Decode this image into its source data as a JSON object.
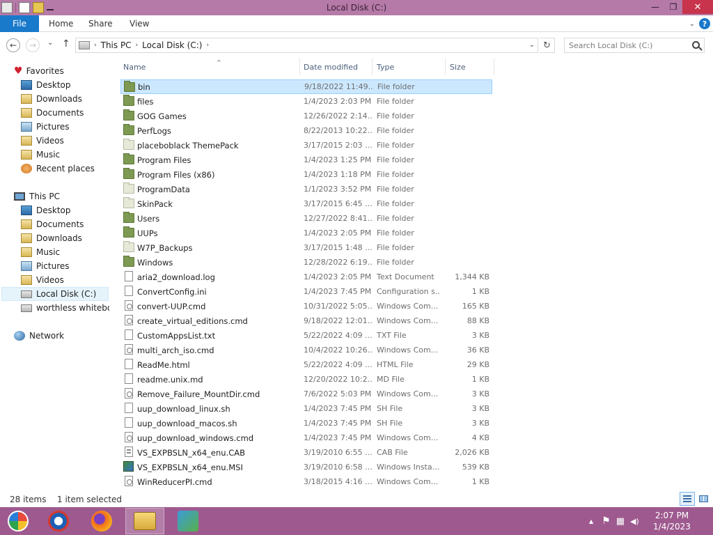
{
  "window": {
    "title": "Local Disk (C:)",
    "minimize_glyph": "—",
    "restore_glyph": "❐",
    "close_glyph": "✕"
  },
  "ribbon": {
    "tabs": [
      "File",
      "Home",
      "Share",
      "View"
    ],
    "expand_glyph": "⌄",
    "help_glyph": "?"
  },
  "nav": {
    "back_glyph": "←",
    "forward_glyph": "→",
    "recent_glyph": "⌄",
    "up_glyph": "↑",
    "refresh_glyph": "↻"
  },
  "address": {
    "segments": [
      "This PC",
      "Local Disk (C:)"
    ],
    "separator_glyph": "›",
    "dropdown_glyph": "⌄"
  },
  "search": {
    "placeholder": "Search Local Disk (C:)"
  },
  "navpane": {
    "favorites_label": "Favorites",
    "favorites": [
      "Desktop",
      "Downloads",
      "Documents",
      "Pictures",
      "Videos",
      "Music",
      "Recent places"
    ],
    "thispc_label": "This PC",
    "thispc": [
      "Desktop",
      "Documents",
      "Downloads",
      "Music",
      "Pictures",
      "Videos",
      "Local Disk (C:)",
      "worthless whiteboard"
    ],
    "network_label": "Network"
  },
  "columns": {
    "name": "Name",
    "date": "Date modified",
    "type": "Type",
    "size": "Size",
    "sort_glyph": "^"
  },
  "files": [
    {
      "name": "bin",
      "date": "9/18/2022 11:49...",
      "type": "File folder",
      "size": ""
    },
    {
      "name": "files",
      "date": "1/4/2023 2:03 PM",
      "type": "File folder",
      "size": ""
    },
    {
      "name": "GOG Games",
      "date": "12/26/2022 2:14...",
      "type": "File folder",
      "size": ""
    },
    {
      "name": "PerfLogs",
      "date": "8/22/2013 10:22...",
      "type": "File folder",
      "size": ""
    },
    {
      "name": "placeboblack ThemePack",
      "date": "3/17/2015 2:03 ...",
      "type": "File folder",
      "size": ""
    },
    {
      "name": "Program Files",
      "date": "1/4/2023 1:25 PM",
      "type": "File folder",
      "size": ""
    },
    {
      "name": "Program Files (x86)",
      "date": "1/4/2023 1:18 PM",
      "type": "File folder",
      "size": ""
    },
    {
      "name": "ProgramData",
      "date": "1/1/2023 3:52 PM",
      "type": "File folder",
      "size": ""
    },
    {
      "name": "SkinPack",
      "date": "3/17/2015 6:45 ...",
      "type": "File folder",
      "size": ""
    },
    {
      "name": "Users",
      "date": "12/27/2022 8:41...",
      "type": "File folder",
      "size": ""
    },
    {
      "name": "UUPs",
      "date": "1/4/2023 2:05 PM",
      "type": "File folder",
      "size": ""
    },
    {
      "name": "W7P_Backups",
      "date": "3/17/2015 1:48 ...",
      "type": "File folder",
      "size": ""
    },
    {
      "name": "Windows",
      "date": "12/28/2022 6:19...",
      "type": "File folder",
      "size": ""
    },
    {
      "name": "aria2_download.log",
      "date": "1/4/2023 2:05 PM",
      "type": "Text Document",
      "size": "1,344 KB"
    },
    {
      "name": "ConvertConfig.ini",
      "date": "1/4/2023 7:45 PM",
      "type": "Configuration s...",
      "size": "1 KB"
    },
    {
      "name": "convert-UUP.cmd",
      "date": "10/31/2022 5:05...",
      "type": "Windows Com...",
      "size": "165 KB"
    },
    {
      "name": "create_virtual_editions.cmd",
      "date": "9/18/2022 12:01...",
      "type": "Windows Com...",
      "size": "88 KB"
    },
    {
      "name": "CustomAppsList.txt",
      "date": "5/22/2022 4:09 ...",
      "type": "TXT File",
      "size": "3 KB"
    },
    {
      "name": "multi_arch_iso.cmd",
      "date": "10/4/2022 10:26...",
      "type": "Windows Com...",
      "size": "36 KB"
    },
    {
      "name": "ReadMe.html",
      "date": "5/22/2022 4:09 ...",
      "type": "HTML File",
      "size": "29 KB"
    },
    {
      "name": "readme.unix.md",
      "date": "12/20/2022 10:2...",
      "type": "MD File",
      "size": "1 KB"
    },
    {
      "name": "Remove_Failure_MountDir.cmd",
      "date": "7/6/2022 5:03 PM",
      "type": "Windows Com...",
      "size": "3 KB"
    },
    {
      "name": "uup_download_linux.sh",
      "date": "1/4/2023 7:45 PM",
      "type": "SH File",
      "size": "3 KB"
    },
    {
      "name": "uup_download_macos.sh",
      "date": "1/4/2023 7:45 PM",
      "type": "SH File",
      "size": "3 KB"
    },
    {
      "name": "uup_download_windows.cmd",
      "date": "1/4/2023 7:45 PM",
      "type": "Windows Com...",
      "size": "4 KB"
    },
    {
      "name": "VS_EXPBSLN_x64_enu.CAB",
      "date": "3/19/2010 6:55 ...",
      "type": "CAB File",
      "size": "2,026 KB"
    },
    {
      "name": "VS_EXPBSLN_x64_enu.MSI",
      "date": "3/19/2010 6:58 ...",
      "type": "Windows Insta...",
      "size": "539 KB"
    },
    {
      "name": "WinReducerPI.cmd",
      "date": "3/18/2015 4:16 ...",
      "type": "Windows Com...",
      "size": "1 KB"
    }
  ],
  "status": {
    "count": "28 items",
    "selection": "1 item selected"
  },
  "taskbar": {
    "time": "2:07 PM",
    "date": "1/4/2023",
    "tray_up_glyph": "▲",
    "flag_glyph": "⚑",
    "network_glyph": "▦",
    "volume_glyph": "◀)"
  }
}
